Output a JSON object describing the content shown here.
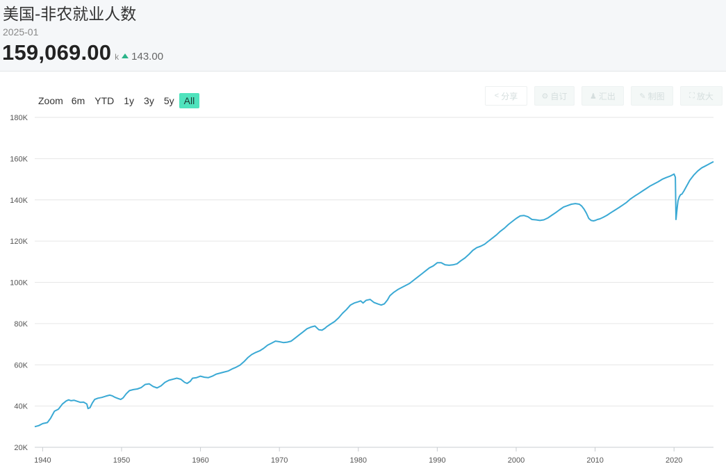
{
  "header": {
    "title": "美国-非农就业人数",
    "period": "2025-01",
    "value": "159,069.00",
    "unit": "k",
    "change": "143.00",
    "change_direction": "up",
    "change_color": "#2bb489"
  },
  "range_selector": {
    "label": "Zoom",
    "buttons": [
      "6m",
      "YTD",
      "1y",
      "3y",
      "5y",
      "All"
    ],
    "active": "All",
    "active_color": "#4fe3bd"
  },
  "toolbar": {
    "share": {
      "label": "分享",
      "icon": "share-icon"
    },
    "custom": {
      "label": "自订",
      "icon": "gear-icon"
    },
    "export": {
      "label": "汇出",
      "icon": "user-icon"
    },
    "draw": {
      "label": "制图",
      "icon": "pencil-icon"
    },
    "fullscreen": {
      "label": "放大",
      "icon": "expand-icon"
    }
  },
  "chart_data": {
    "type": "line",
    "line_color": "#3aa9d4",
    "grid": true,
    "legend": "none",
    "xlim": [
      1939,
      2025
    ],
    "ylim": [
      20,
      180
    ],
    "y_ticks": [
      {
        "value": 20,
        "label": "20K"
      },
      {
        "value": 40,
        "label": "40K"
      },
      {
        "value": 60,
        "label": "60K"
      },
      {
        "value": 80,
        "label": "80K"
      },
      {
        "value": 100,
        "label": "100K"
      },
      {
        "value": 120,
        "label": "120K"
      },
      {
        "value": 140,
        "label": "140K"
      },
      {
        "value": 160,
        "label": "160K"
      },
      {
        "value": 180,
        "label": "180K"
      }
    ],
    "x_ticks": [
      {
        "value": 1940,
        "label": "1940"
      },
      {
        "value": 1950,
        "label": "1950"
      },
      {
        "value": 1960,
        "label": "1960"
      },
      {
        "value": 1970,
        "label": "1970"
      },
      {
        "value": 1980,
        "label": "1980"
      },
      {
        "value": 1990,
        "label": "1990"
      },
      {
        "value": 2000,
        "label": "2000"
      },
      {
        "value": 2010,
        "label": "2010"
      },
      {
        "value": 2020,
        "label": "2020"
      }
    ],
    "series": [
      {
        "x": [
          1939.0,
          1939.5,
          1940.0,
          1940.6,
          1941.0,
          1941.5,
          1942.0,
          1942.5,
          1943.0,
          1943.3,
          1943.6,
          1944.0,
          1944.4,
          1944.8,
          1945.2,
          1945.6,
          1945.75,
          1946.0,
          1946.3,
          1946.6,
          1947.0,
          1947.5,
          1948.0,
          1948.5,
          1948.8,
          1949.2,
          1949.6,
          1949.9,
          1950.2,
          1950.6,
          1951.0,
          1951.5,
          1952.0,
          1952.5,
          1953.0,
          1953.5,
          1954.0,
          1954.5,
          1955.0,
          1955.5,
          1956.0,
          1956.5,
          1957.0,
          1957.5,
          1958.0,
          1958.3,
          1958.7,
          1959.0,
          1959.5,
          1960.0,
          1960.5,
          1961.0,
          1961.5,
          1962.0,
          1962.5,
          1963.0,
          1963.5,
          1964.0,
          1964.5,
          1965.0,
          1965.5,
          1966.0,
          1966.5,
          1967.0,
          1967.5,
          1968.0,
          1968.5,
          1969.0,
          1969.5,
          1970.0,
          1970.5,
          1971.0,
          1971.5,
          1972.0,
          1972.5,
          1973.0,
          1973.5,
          1974.0,
          1974.5,
          1975.0,
          1975.4,
          1975.8,
          1976.0,
          1976.5,
          1977.0,
          1977.5,
          1978.0,
          1978.5,
          1979.0,
          1979.5,
          1980.0,
          1980.3,
          1980.6,
          1981.0,
          1981.5,
          1982.0,
          1982.5,
          1982.9,
          1983.3,
          1983.7,
          1984.0,
          1984.5,
          1985.0,
          1985.5,
          1986.0,
          1986.5,
          1987.0,
          1987.5,
          1988.0,
          1988.5,
          1989.0,
          1989.5,
          1990.0,
          1990.5,
          1991.0,
          1991.5,
          1992.0,
          1992.5,
          1993.0,
          1993.5,
          1994.0,
          1994.5,
          1995.0,
          1995.5,
          1996.0,
          1996.5,
          1997.0,
          1997.5,
          1998.0,
          1998.5,
          1999.0,
          1999.5,
          2000.0,
          2000.5,
          2001.0,
          2001.5,
          2002.0,
          2002.5,
          2003.0,
          2003.5,
          2004.0,
          2004.5,
          2005.0,
          2005.5,
          2006.0,
          2006.5,
          2007.0,
          2007.5,
          2008.0,
          2008.3,
          2008.6,
          2008.9,
          2009.2,
          2009.5,
          2009.8,
          2010.0,
          2010.3,
          2010.6,
          2011.0,
          2011.5,
          2012.0,
          2012.5,
          2013.0,
          2013.5,
          2014.0,
          2014.5,
          2015.0,
          2015.5,
          2016.0,
          2016.5,
          2017.0,
          2017.5,
          2018.0,
          2018.5,
          2019.0,
          2019.5,
          2020.0,
          2020.17,
          2020.25,
          2020.33,
          2020.42,
          2020.5,
          2020.67,
          2020.83,
          2021.0,
          2021.25,
          2021.5,
          2021.75,
          2022.0,
          2022.5,
          2023.0,
          2023.5,
          2024.0,
          2024.5,
          2025.0
        ],
        "y": [
          30.0,
          30.5,
          31.5,
          32.0,
          34.0,
          37.5,
          38.5,
          41.0,
          42.5,
          43.0,
          42.6,
          42.8,
          42.3,
          41.8,
          41.9,
          41.0,
          38.8,
          39.2,
          41.5,
          43.2,
          43.8,
          44.2,
          44.8,
          45.3,
          45.0,
          44.2,
          43.6,
          43.2,
          44.0,
          46.0,
          47.5,
          48.0,
          48.3,
          49.0,
          50.5,
          50.8,
          49.5,
          48.8,
          49.8,
          51.5,
          52.5,
          53.0,
          53.5,
          53.0,
          51.5,
          51.0,
          52.0,
          53.5,
          53.8,
          54.5,
          54.0,
          53.8,
          54.5,
          55.5,
          56.0,
          56.5,
          57.0,
          58.0,
          58.8,
          59.8,
          61.5,
          63.5,
          65.0,
          66.0,
          66.8,
          68.0,
          69.5,
          70.5,
          71.5,
          71.2,
          70.8,
          71.0,
          71.5,
          73.0,
          74.5,
          76.0,
          77.5,
          78.3,
          78.8,
          77.0,
          76.8,
          77.8,
          78.5,
          79.8,
          81.0,
          82.8,
          85.0,
          86.8,
          89.0,
          90.0,
          90.6,
          91.0,
          90.0,
          91.3,
          91.7,
          90.2,
          89.5,
          89.0,
          89.6,
          91.5,
          93.5,
          95.2,
          96.5,
          97.5,
          98.5,
          99.5,
          101.0,
          102.5,
          104.0,
          105.5,
          107.0,
          108.0,
          109.5,
          109.5,
          108.5,
          108.3,
          108.5,
          109.0,
          110.5,
          111.8,
          113.5,
          115.5,
          116.8,
          117.5,
          118.5,
          120.0,
          121.5,
          123.0,
          124.8,
          126.2,
          128.0,
          129.5,
          131.0,
          132.2,
          132.4,
          131.8,
          130.5,
          130.3,
          130.0,
          130.3,
          131.2,
          132.5,
          133.8,
          135.2,
          136.5,
          137.2,
          137.9,
          138.2,
          137.9,
          137.0,
          135.5,
          133.5,
          131.0,
          130.0,
          129.8,
          130.0,
          130.5,
          130.8,
          131.5,
          132.5,
          133.8,
          135.0,
          136.2,
          137.5,
          138.8,
          140.5,
          141.8,
          143.0,
          144.3,
          145.5,
          146.8,
          147.8,
          148.8,
          150.0,
          150.8,
          151.5,
          152.5,
          151.0,
          130.5,
          133.5,
          137.0,
          139.5,
          141.5,
          142.5,
          142.8,
          144.3,
          146.0,
          147.8,
          149.5,
          152.0,
          154.0,
          155.5,
          156.5,
          157.5,
          158.5
        ]
      }
    ]
  }
}
